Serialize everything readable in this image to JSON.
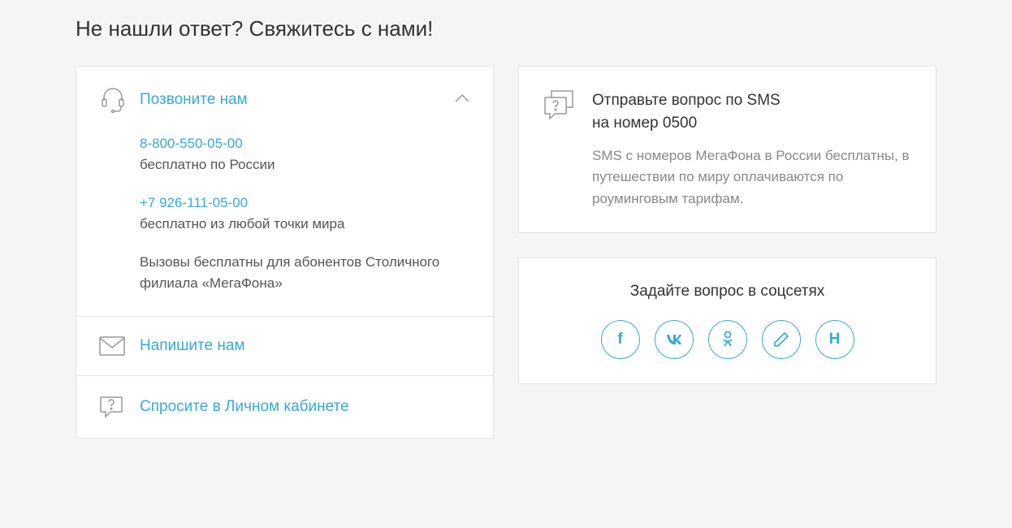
{
  "heading": "Не нашли ответ? Свяжитесь с нами!",
  "call": {
    "title": "Позвоните нам",
    "phone1": "8-800-550-05-00",
    "phone1_note": "бесплатно по России",
    "phone2": "+7 926-111-05-00",
    "phone2_note": "бесплатно из любой точки мира",
    "footnote": "Вызовы бесплатны для абонентов Столичного филиала «МегаФона»"
  },
  "write": {
    "title": "Напишите нам"
  },
  "cabinet": {
    "title": "Спросите в Личном кабинете"
  },
  "sms": {
    "title_line1": "Отправьте вопрос по SMS",
    "title_line2": "на номер 0500",
    "desc": "SMS с номеров МегаФона в России бесплатны, в путешествии по миру оплачиваются по роуминговым тарифам."
  },
  "social": {
    "title": "Задайте вопрос в соцсетях",
    "fb": "f",
    "vk": "w",
    "ok": "ok",
    "habr": "H"
  }
}
